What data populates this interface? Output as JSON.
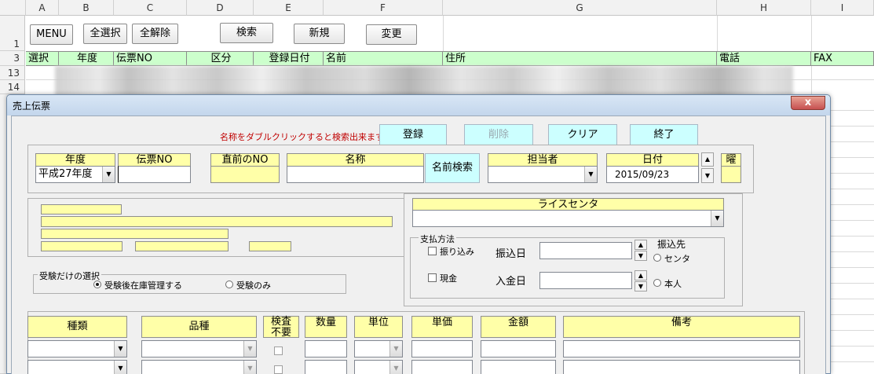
{
  "sheet": {
    "columns": [
      "A",
      "B",
      "C",
      "D",
      "E",
      "F",
      "G",
      "H",
      "I"
    ],
    "rows": [
      "1",
      "3",
      "13",
      "14"
    ],
    "buttons": {
      "menu": "MENU",
      "select_all": "全選択",
      "deselect_all": "全解除",
      "search": "検索",
      "new": "新規",
      "change": "変更"
    },
    "headers": [
      "選択",
      "年度",
      "伝票NO",
      "区分",
      "登録日付",
      "名前",
      "住所",
      "電話",
      "FAX"
    ],
    "header_color": "#ccffcc"
  },
  "dialog": {
    "title": "売上伝票",
    "close_glyph": "x",
    "hint": "名称をダブルクリックすると検索出来ます",
    "buttons": {
      "register": "登録",
      "delete": "削除",
      "clear": "クリア",
      "exit": "終了",
      "name_search": "名前検索"
    },
    "fields": {
      "year_label": "年度",
      "year_value": "平成27年度",
      "slip_label": "伝票NO",
      "slip_value": "",
      "prev_label": "直前のNO",
      "name_label": "名称",
      "staff_label": "担当者",
      "date_label": "日付",
      "date_value": "2015/09/23",
      "weekday_label": "曜",
      "rice_center_label": "ライスセンタ"
    },
    "exam": {
      "title": "受験だけの選択",
      "opt_manage": "受験後在庫管理する",
      "opt_only": "受験のみ",
      "selected": "opt_manage"
    },
    "payment": {
      "title": "支払方法",
      "transfer": "振り込み",
      "cash": "現金",
      "transfer_date": "振込日",
      "deposit_date": "入金日",
      "destination_title": "振込先",
      "dest_center": "センタ",
      "dest_person": "本人"
    },
    "grid": {
      "columns": [
        "種類",
        "品種",
        "検査不要",
        "数量",
        "単位",
        "単価",
        "金額",
        "備考"
      ]
    },
    "accent_yellow": "#ffffa8",
    "button_cyan": "#ccffff",
    "hint_color": "#c00000"
  }
}
